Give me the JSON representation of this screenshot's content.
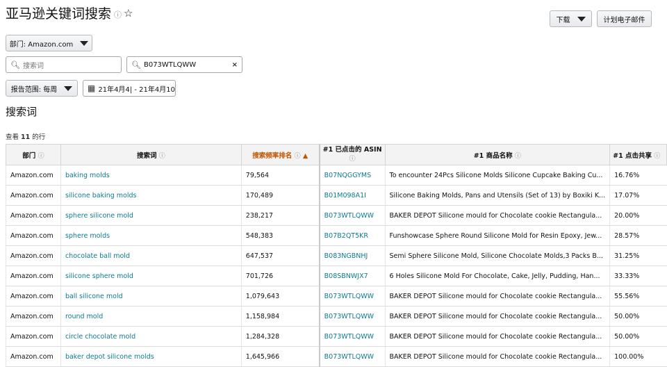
{
  "header": {
    "title": "亚马逊关键词搜索",
    "info_icon": "info-icon",
    "star_icon": "star-icon",
    "download_label": "下载",
    "schedule_email_label": "计划电子邮件"
  },
  "filters": {
    "department_label": "部门: Amazon.com",
    "search_term_placeholder": "搜索词",
    "asin_value": "B073WTLQWW",
    "clear_icon": "×",
    "report_range_label": "报告范围: 每周",
    "date_range_value": "21年4月4| - 21年4月10"
  },
  "section_title": "搜索词",
  "row_count": {
    "prefix": "查看 ",
    "count": "11",
    "suffix": " 的行"
  },
  "table": {
    "headers": {
      "department": "部门",
      "search_term": "搜索词",
      "rank": "搜索频率排名",
      "asin": "#1 已点击的 ASIN",
      "product": "#1 商品名称",
      "share": "#1 点击共享"
    },
    "rows": [
      {
        "department": "Amazon.com",
        "search_term": "baking molds",
        "rank": "79,564",
        "asin": "B07NQGGYMS",
        "product": "To encounter 24Pcs Silicone Molds Silicone Cupcake Baking Cu...",
        "share": "16.76%"
      },
      {
        "department": "Amazon.com",
        "search_term": "silicone baking molds",
        "rank": "170,489",
        "asin": "B01M098A1I",
        "product": "Silicone Baking Molds, Pans and Utensils (Set of 13) by Boxiki K...",
        "share": "17.07%"
      },
      {
        "department": "Amazon.com",
        "search_term": "sphere silicone mold",
        "rank": "238,217",
        "asin": "B073WTLQWW",
        "product": "BAKER DEPOT Silicone mould for Chocolate cookie Rectangula...",
        "share": "20.00%"
      },
      {
        "department": "Amazon.com",
        "search_term": "sphere molds",
        "rank": "548,383",
        "asin": "B07B2QT5KR",
        "product": "Funshowcase Sphere Round Silicone Mold for Resin Epoxy, Jew...",
        "share": "28.57%"
      },
      {
        "department": "Amazon.com",
        "search_term": "chocolate ball mold",
        "rank": "647,537",
        "asin": "B083NGBNHJ",
        "product": "Semi Sphere Silicone Mold, Silicone Chocolate Molds,3 Packs B...",
        "share": "31.25%"
      },
      {
        "department": "Amazon.com",
        "search_term": "silicone sphere mold",
        "rank": "701,726",
        "asin": "B08SBNWJX7",
        "product": "6 Holes Silicone Mold For Chocolate, Cake, Jelly, Pudding, Han...",
        "share": "33.33%"
      },
      {
        "department": "Amazon.com",
        "search_term": "ball silicone mold",
        "rank": "1,079,643",
        "asin": "B073WTLQWW",
        "product": "BAKER DEPOT Silicone mould for Chocolate cookie Rectangula...",
        "share": "55.56%"
      },
      {
        "department": "Amazon.com",
        "search_term": "round mold",
        "rank": "1,158,984",
        "asin": "B073WTLQWW",
        "product": "BAKER DEPOT Silicone mould for Chocolate cookie Rectangula...",
        "share": "50.00%"
      },
      {
        "department": "Amazon.com",
        "search_term": "circle chocolate mold",
        "rank": "1,284,328",
        "asin": "B073WTLQWW",
        "product": "BAKER DEPOT Silicone mould for Chocolate cookie Rectangula...",
        "share": "50.00%"
      },
      {
        "department": "Amazon.com",
        "search_term": "baker depot silicone molds",
        "rank": "1,645,966",
        "asin": "B073WTLQWW",
        "product": "BAKER DEPOT Silicone mould for Chocolate cookie Rectangula...",
        "share": "100.00%"
      }
    ]
  },
  "colors": {
    "link": "#0c7b8e",
    "sorted_header": "#c45500"
  }
}
